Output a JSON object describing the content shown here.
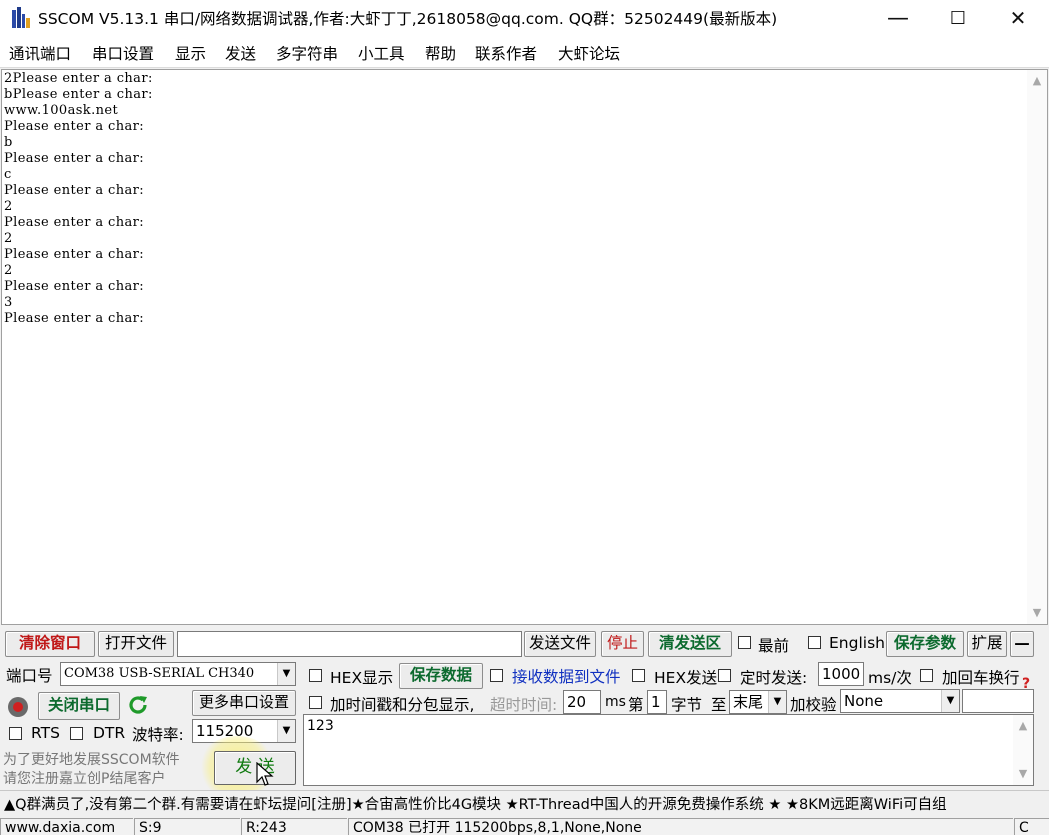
{
  "window": {
    "title": "SSCOM V5.13.1 串口/网络数据调试器,作者:大虾丁丁,2618058@qq.com. QQ群：52502449(最新版本)",
    "minimize_symbol": "—",
    "maximize_symbol": "☐",
    "close_symbol": "✕"
  },
  "menu": [
    "通讯端口",
    "串口设置",
    "显示",
    "发送",
    "多字符串",
    "小工具",
    "帮助",
    "联系作者",
    "大虾论坛"
  ],
  "receive": {
    "lines": [
      "2Please enter a char:",
      "bPlease enter a char:",
      "www.100ask.net",
      "Please enter a char:",
      "b",
      "Please enter a char:",
      "c",
      "Please enter a char:",
      "2",
      "Please enter a char:",
      "2",
      "Please enter a char:",
      "2",
      "Please enter a char:",
      "3",
      "Please enter a char:"
    ]
  },
  "toolbar": {
    "clear_window": "清除窗口",
    "open_file": "打开文件",
    "file_path": "",
    "send_file": "发送文件",
    "stop": "停止",
    "clear_send_area": "清发送区",
    "topmost": "最前",
    "english": "English",
    "save_params": "保存参数",
    "expand": "扩展",
    "collapse": "—"
  },
  "port": {
    "port_label": "端口号",
    "port_value": "COM38 USB-SERIAL CH340",
    "close_port": "关闭串口",
    "more_settings": "更多串口设置",
    "rts": "RTS",
    "dtr": "DTR",
    "baud_label": "波特率:",
    "baud_value": "115200"
  },
  "options": {
    "hex_display": "HEX显示",
    "save_data": "保存数据",
    "recv_to_file": "接收数据到文件",
    "hex_send": "HEX发送",
    "timed_send": "定时发送:",
    "interval": "1000",
    "interval_unit": "ms/次",
    "add_crlf": "加回车换行",
    "help": "?",
    "timestamp": "加时间戳和分包显示,",
    "timeout_label": "超时时间:",
    "timeout": "20",
    "timeout_unit": "ms",
    "nth_label": "第",
    "nth_value": "1",
    "byte_label": "字节",
    "to_label": "至",
    "end_value": "末尾",
    "checksum_label": "加校验",
    "checksum_value": "None"
  },
  "send": {
    "text": "123",
    "button": "发 送",
    "promo_line1": "为了更好地发展SSCOM软件",
    "promo_line2": "请您注册嘉立创P结尾客户"
  },
  "ticker": "▲Q群满员了,没有第二个群.有需要请在虾坛提问[注册]★合宙高性价比4G模块 ★RT-Thread中国人的开源免费操作系统 ★ ★8KM远距离WiFi可自组",
  "status": {
    "site": "www.daxia.com",
    "sent": "S:9",
    "received": "R:243",
    "port_state": "COM38 已打开  115200bps,8,1,None,None",
    "extra": "C"
  },
  "colors": {
    "red_button_text": "#c01818",
    "green_button_text": "#107a10",
    "link_blue": "#1030c0"
  }
}
